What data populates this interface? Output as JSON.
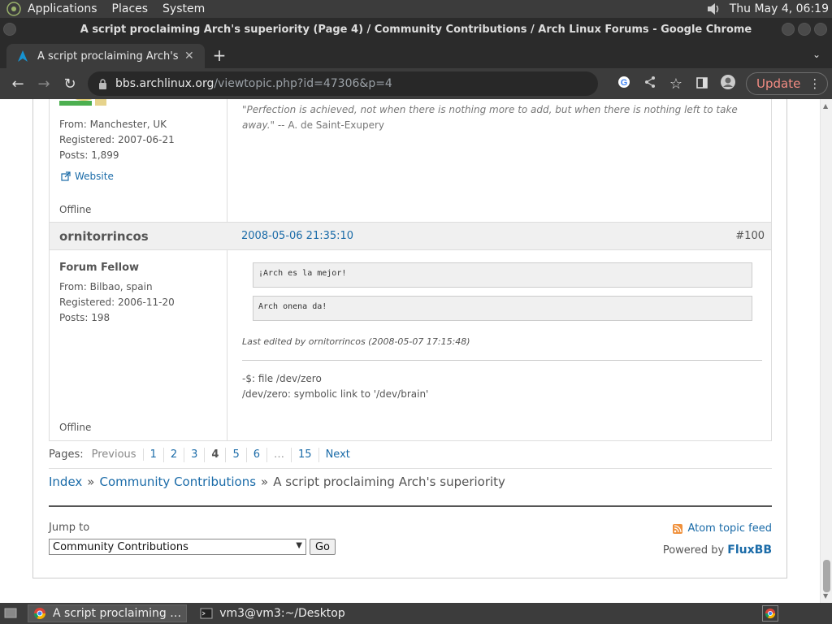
{
  "top_panel": {
    "menu": [
      "Applications",
      "Places",
      "System"
    ],
    "clock": "Thu May  4, 06:19"
  },
  "window": {
    "title": "A script proclaiming Arch's superiority (Page 4) / Community Contributions / Arch Linux Forums - Google Chrome"
  },
  "browser": {
    "tab_title": "A script proclaiming Arch's superiority (Page 4) / Community Contributions",
    "url_host": "bbs.archlinux.org",
    "url_path": "/viewtopic.php?id=47306&p=4",
    "update_label": "Update",
    "icons": [
      "back-icon",
      "forward-icon",
      "reload-icon",
      "lock-icon",
      "google-icon",
      "share-icon",
      "star-icon",
      "side-panel-icon",
      "profile-icon",
      "menu-icon"
    ]
  },
  "post1": {
    "signature_quote": "\"Perfection is achieved, not when there is nothing more to add, but when there is nothing left to take away.\"",
    "signature_author": " -- A. de Saint-Exupery",
    "from": "From: Manchester, UK",
    "registered": "Registered: 2007-06-21",
    "posts": "Posts: 1,899",
    "website": "Website",
    "status": "Offline"
  },
  "post2": {
    "author": "ornitorrincos",
    "date": "2008-05-06 21:35:10",
    "number": "#100",
    "title": "Forum Fellow",
    "from": "From: Bilbao, spain",
    "registered": "Registered: 2006-11-20",
    "posts": "Posts: 198",
    "code1": "¡Arch es la mejor!",
    "code2": "Arch onena da!",
    "edited": "Last edited by ornitorrincos (2008-05-07 17:15:48)",
    "sig_line1": "-$: file /dev/zero",
    "sig_line2": "/dev/zero: symbolic link to '/dev/brain'",
    "status": "Offline"
  },
  "pagination": {
    "label": "Pages:",
    "previous": "Previous",
    "pages": [
      "1",
      "2",
      "3",
      "4",
      "5",
      "6",
      "…",
      "15"
    ],
    "current": "4",
    "next": "Next"
  },
  "breadcrumb": {
    "index": "Index",
    "forum": "Community Contributions",
    "topic": "A script proclaiming Arch's superiority",
    "separator": "»"
  },
  "footer": {
    "jump_label": "Jump to",
    "jump_selected": "Community Contributions",
    "go_label": "Go",
    "atom_feed": "Atom topic feed",
    "powered_prefix": "Powered by ",
    "powered_brand": "FluxBB"
  },
  "taskbar": {
    "tasks": [
      "A script proclaiming …",
      "vm3@vm3:~/Desktop"
    ]
  },
  "colors": {
    "link": "#1a6ba8",
    "panel": "#3c3c3c",
    "update_text": "#f28b82"
  }
}
